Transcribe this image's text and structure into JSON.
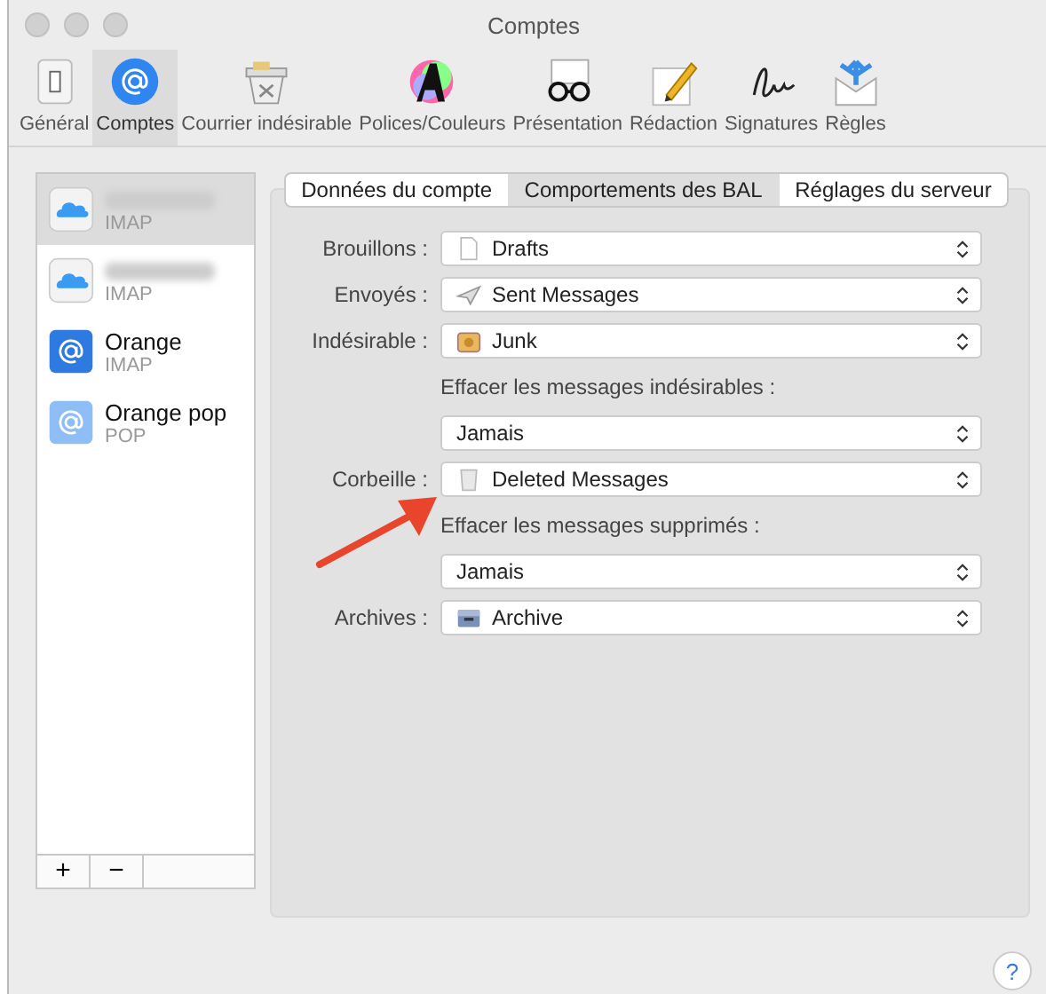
{
  "window": {
    "title": "Comptes"
  },
  "toolbar": [
    {
      "label": "Général",
      "kind": "switch",
      "selected": false
    },
    {
      "label": "Comptes",
      "kind": "at",
      "selected": true
    },
    {
      "label": "Courrier indésirable",
      "kind": "junk",
      "selected": false
    },
    {
      "label": "Polices/Couleurs",
      "kind": "font",
      "selected": false
    },
    {
      "label": "Présentation",
      "kind": "glasses",
      "selected": false
    },
    {
      "label": "Rédaction",
      "kind": "pencil",
      "selected": false
    },
    {
      "label": "Signatures",
      "kind": "signature",
      "selected": false
    },
    {
      "label": "Règles",
      "kind": "rules",
      "selected": false
    }
  ],
  "accounts": [
    {
      "kind": "cloud",
      "type": "IMAP",
      "selected": true
    },
    {
      "kind": "cloud",
      "type": "IMAP",
      "selected": false
    },
    {
      "kind": "at",
      "name": "Orange",
      "type": "IMAP",
      "selected": false
    },
    {
      "kind": "at-light",
      "name": "Orange pop",
      "type": "POP",
      "selected": false
    }
  ],
  "list_buttons": [
    "+",
    "−"
  ],
  "tabs": [
    {
      "label": "Données du compte",
      "selected": false
    },
    {
      "label": "Comportements des BAL",
      "selected": true
    },
    {
      "label": "Réglages du serveur",
      "selected": false
    }
  ],
  "form": [
    {
      "kind": "page",
      "label": "Brouillons :",
      "value": "Drafts"
    },
    {
      "kind": "plane",
      "label": "Envoyés :",
      "value": "Sent Messages"
    },
    {
      "kind": "junk",
      "label": "Indésirable :",
      "value": "Junk"
    },
    {
      "kind": "caption",
      "label": "Effacer les messages indésirables :"
    },
    {
      "kind": "plain",
      "value": "Jamais"
    },
    {
      "kind": "trash",
      "label": "Corbeille :",
      "value": "Deleted Messages"
    },
    {
      "kind": "caption",
      "label": "Effacer les messages supprimés :"
    },
    {
      "kind": "plain",
      "value": "Jamais"
    },
    {
      "kind": "archive",
      "label": "Archives :",
      "value": "Archive"
    }
  ],
  "help_button": "?"
}
